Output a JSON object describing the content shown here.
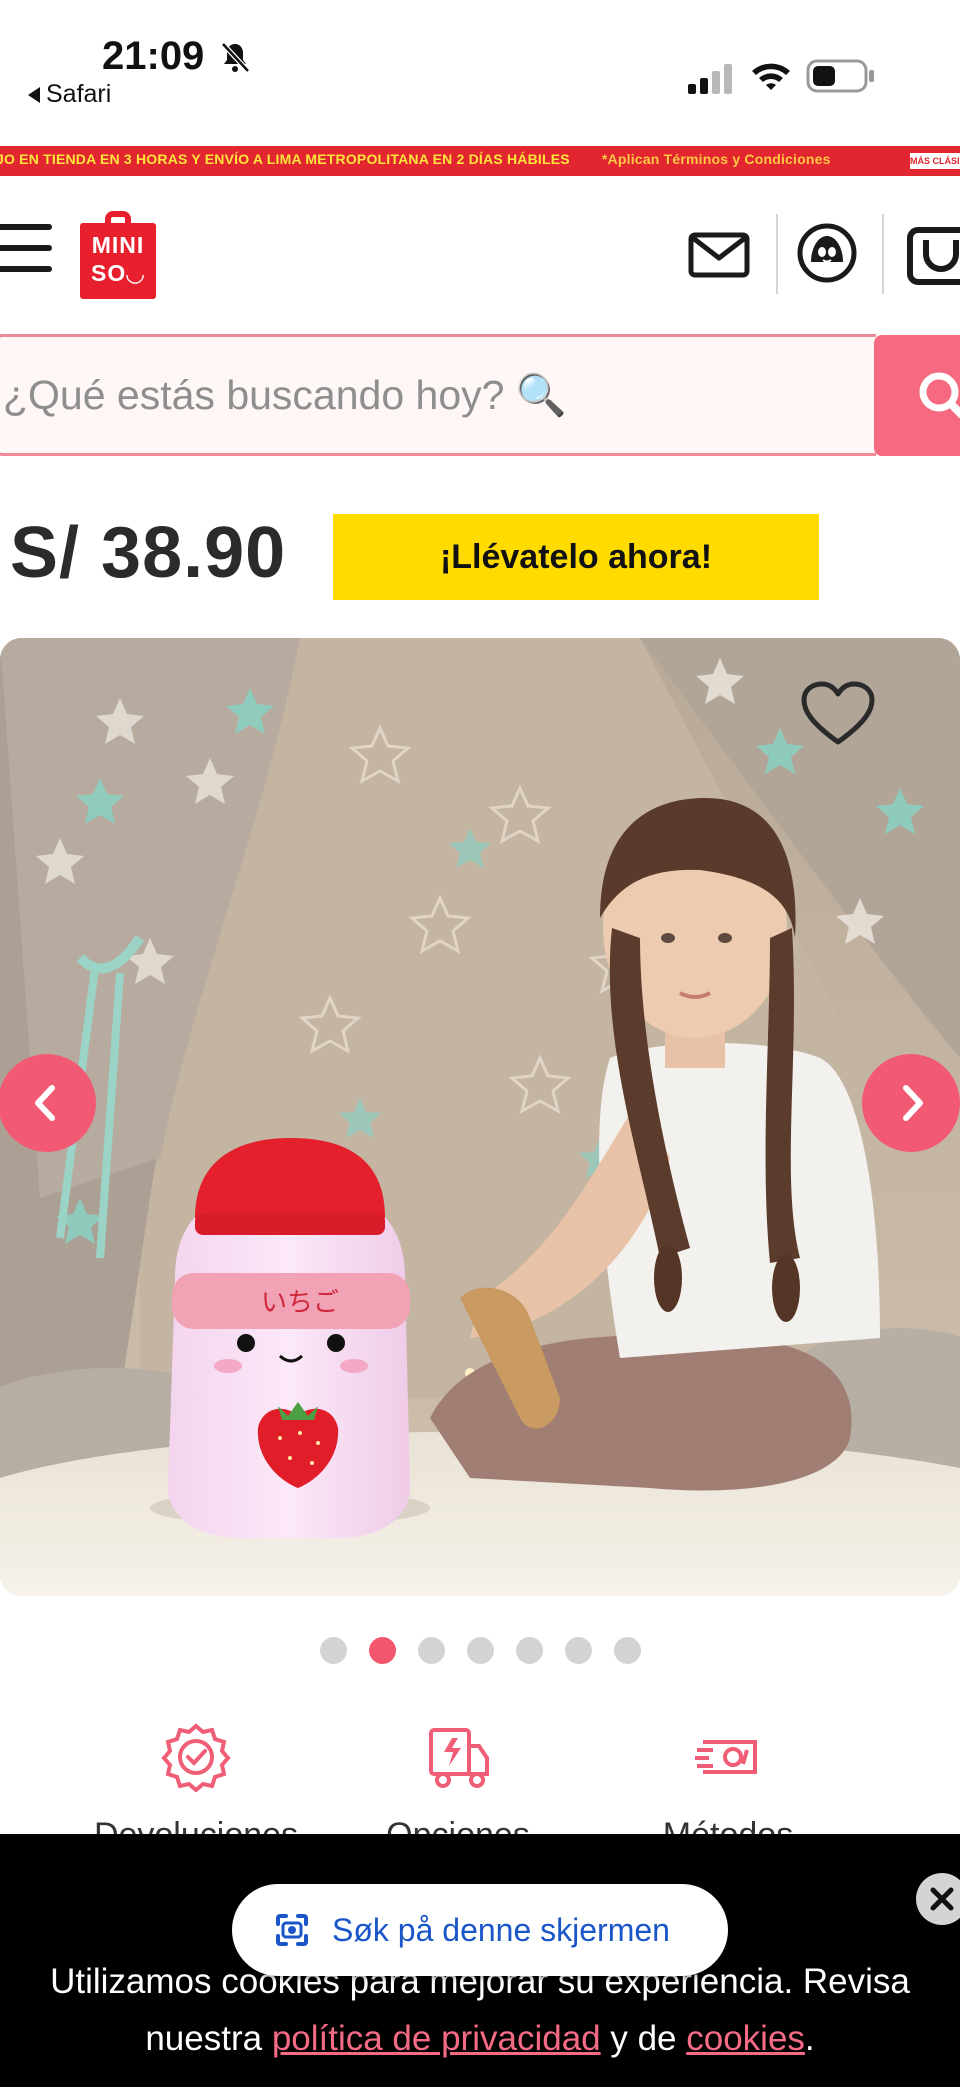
{
  "status_bar": {
    "time": "21:09",
    "back_app": "Safari"
  },
  "promo": {
    "text_main": "JO EN TIENDA EN 3 HORAS Y ENVÍO A LIMA METROPOLITANA EN 2 DÍAS HÁBILES",
    "text_terms": "*Aplican Términos y Condiciones",
    "tag": "MÁS CLÁSICOS"
  },
  "header": {
    "logo_line1": "MINI",
    "logo_line2": "SO◡"
  },
  "search": {
    "placeholder": "¿Qué estás buscando hoy? 🔍"
  },
  "product": {
    "price": "S/ 38.90",
    "buy_now_label": "¡Llévatelo ahora!",
    "badge_text": "いちご"
  },
  "gallery": {
    "total_images": 7,
    "active_index": 2
  },
  "features": [
    {
      "label": "Devoluciones",
      "icon": "badge-check-icon"
    },
    {
      "label": "Opciones",
      "icon": "delivery-truck-icon"
    },
    {
      "label": "Métodos",
      "icon": "payment-icon"
    }
  ],
  "lens": {
    "label": "Søk på denne skjermen"
  },
  "cookie": {
    "line1": "Utilizamos cookies para mejorar su experiencia. Revisa",
    "line2_prefix": "nuestra ",
    "privacy_link": "política de privacidad",
    "line2_mid": " y de ",
    "cookies_link": "cookies",
    "line2_suffix": "."
  },
  "colors": {
    "brand_red": "#e8202e",
    "accent_pink": "#f25a74",
    "cta_yellow": "#ffdb00"
  }
}
